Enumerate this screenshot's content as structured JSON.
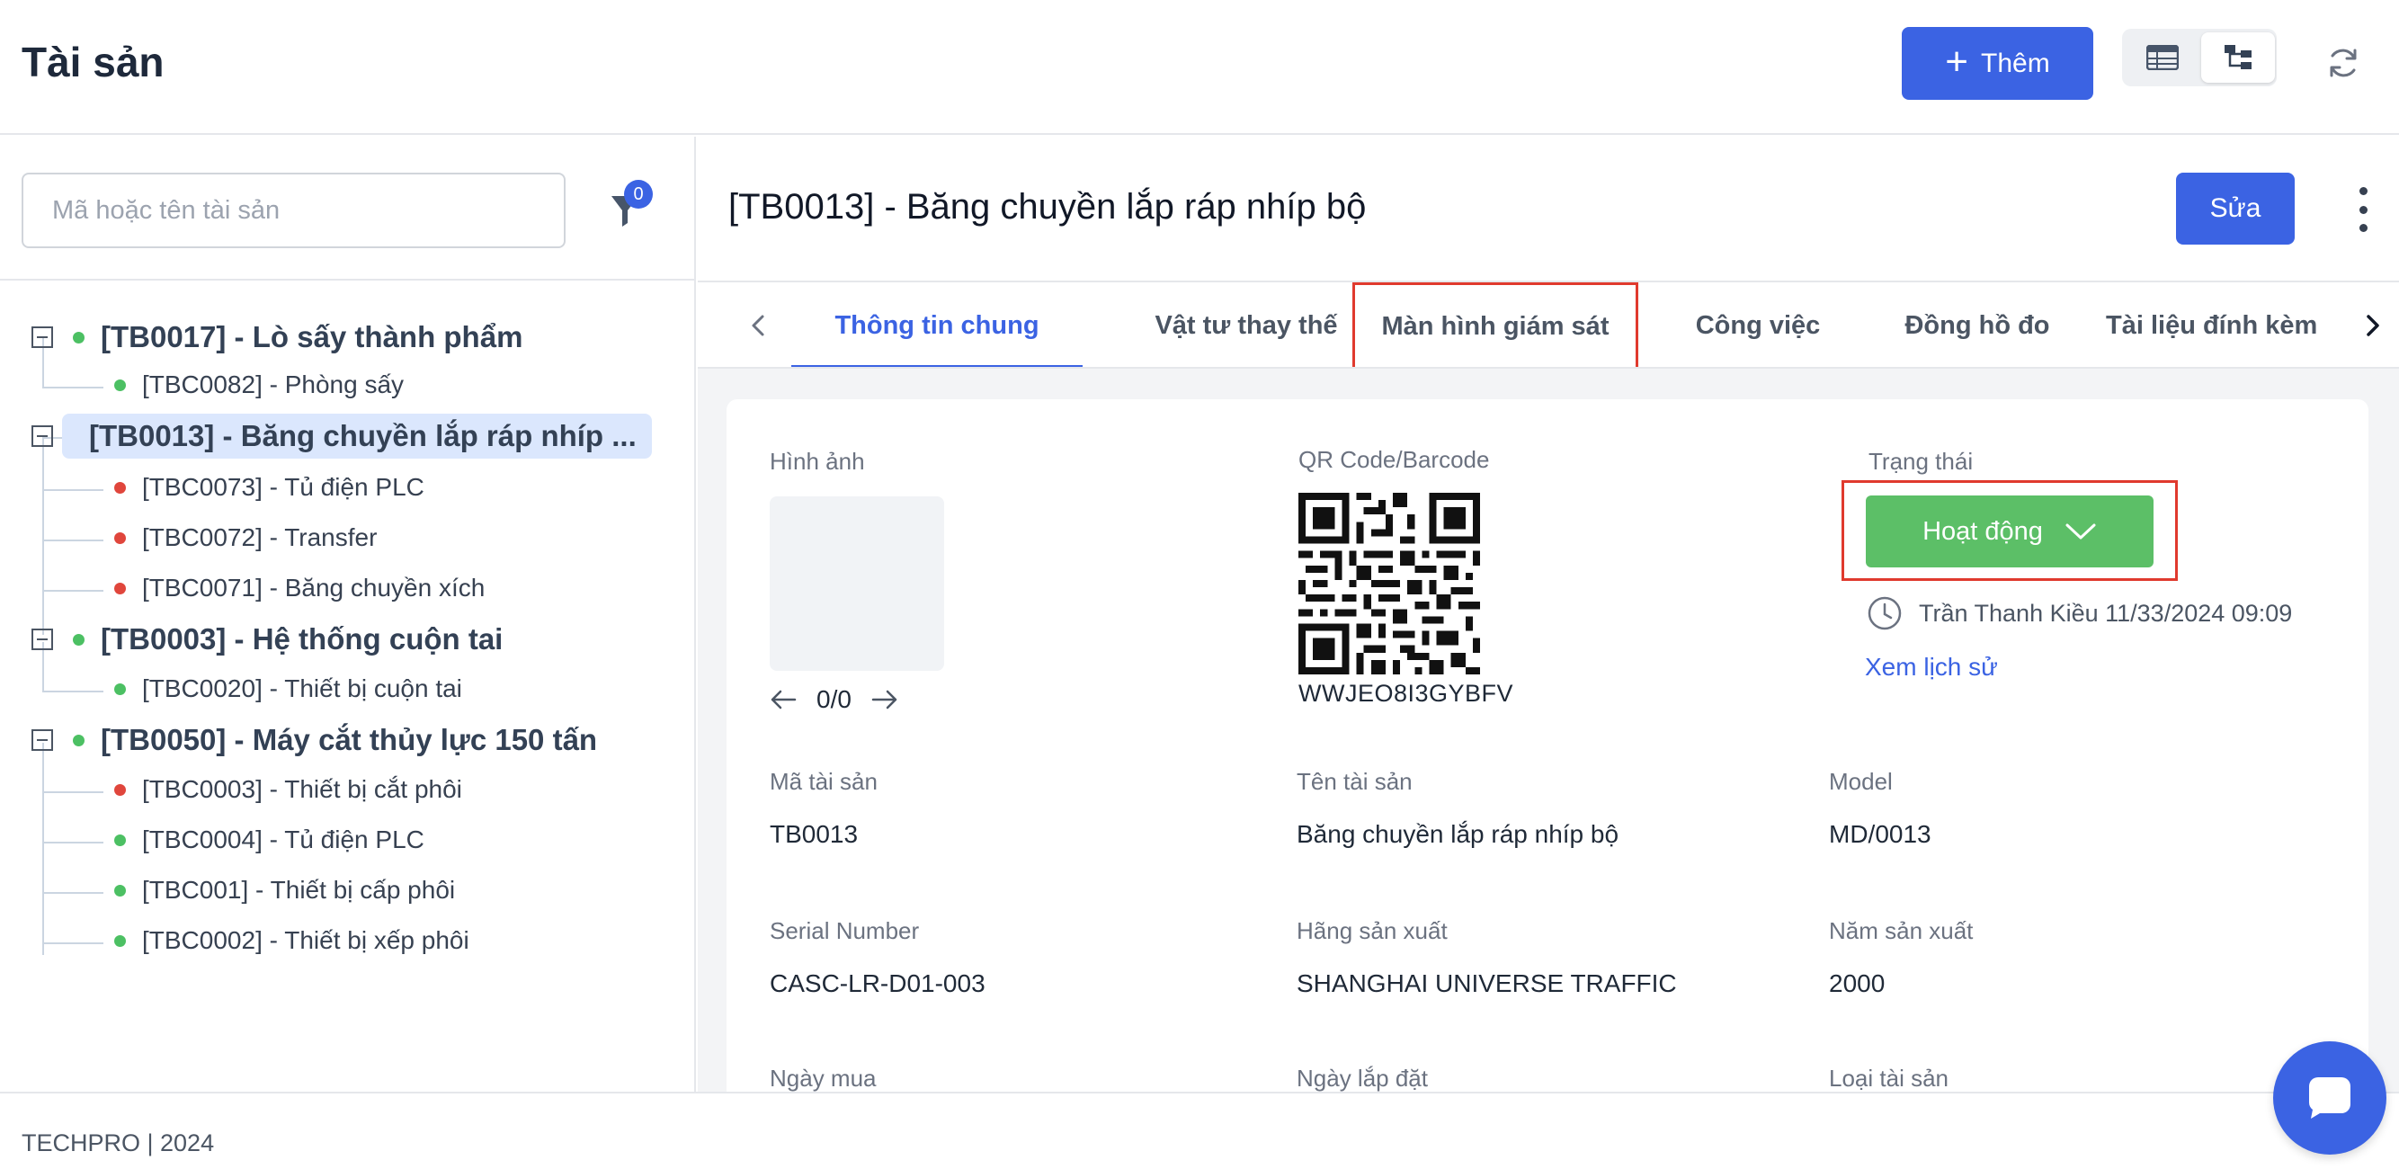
{
  "header": {
    "title": "Tài sản",
    "add_button": "Thêm",
    "view_modes": [
      "table-view-icon",
      "tree-view-icon"
    ],
    "active_view": "tree-view-icon"
  },
  "sidebar": {
    "search_placeholder": "Mã hoặc tên tài sản",
    "filter_count": "0",
    "tree": [
      {
        "label": "[TB0017] - Lò sấy thành phẩm",
        "status": "green",
        "children": [
          {
            "label": "[TBC0082] - Phòng sấy",
            "status": "green"
          }
        ]
      },
      {
        "label": "[TB0013] - Băng chuyền lắp ráp nhíp ...",
        "status": "green",
        "selected": true,
        "children": [
          {
            "label": "[TBC0073] - Tủ điện PLC",
            "status": "red"
          },
          {
            "label": "[TBC0072] - Transfer",
            "status": "red"
          },
          {
            "label": "[TBC0071] - Băng chuyền xích",
            "status": "red"
          }
        ]
      },
      {
        "label": "[TB0003] - Hệ thống cuộn tai",
        "status": "green",
        "children": [
          {
            "label": "[TBC0020] - Thiết bị cuộn tai",
            "status": "green"
          }
        ]
      },
      {
        "label": "[TB0050] - Máy cắt thủy lực 150 tấn",
        "status": "green",
        "children": [
          {
            "label": "[TBC0003] - Thiết bị cắt phôi",
            "status": "red"
          },
          {
            "label": "[TBC0004] - Tủ điện PLC",
            "status": "green"
          },
          {
            "label": "[TBC001] - Thiết bị cấp phôi",
            "status": "green"
          },
          {
            "label": "[TBC0002] - Thiết bị xếp phôi",
            "status": "green"
          }
        ]
      }
    ]
  },
  "detail": {
    "title": "[TB0013] - Băng chuyền lắp ráp nhíp bộ",
    "edit_button": "Sửa",
    "tabs": [
      {
        "label": "Thông tin chung",
        "active": true
      },
      {
        "label": "Vật tư thay thế"
      },
      {
        "label": "Màn hình giám sát",
        "highlighted": true
      },
      {
        "label": "Công việc"
      },
      {
        "label": "Đồng hồ đo"
      },
      {
        "label": "Tài liệu đính kèm"
      }
    ],
    "image": {
      "label": "Hình ảnh",
      "counter": "0/0"
    },
    "qr": {
      "label": "QR Code/Barcode",
      "code": "WWJEO8I3GYBFV"
    },
    "status": {
      "label": "Trạng thái",
      "value": "Hoạt động",
      "updated_by": "Trần Thanh Kiều 11/33/2024 09:09",
      "history_link": "Xem lịch sử"
    },
    "fields": {
      "asset_code": {
        "label": "Mã tài sản",
        "value": "TB0013"
      },
      "asset_name": {
        "label": "Tên tài sản",
        "value": "Băng chuyền lắp ráp nhíp bộ"
      },
      "model": {
        "label": "Model",
        "value": "MD/0013"
      },
      "serial": {
        "label": "Serial Number",
        "value": "CASC-LR-D01-003"
      },
      "manufacturer": {
        "label": "Hãng sản xuất",
        "value": "SHANGHAI UNIVERSE TRAFFIC"
      },
      "year": {
        "label": "Năm sản xuất",
        "value": "2000"
      },
      "purchase_date": {
        "label": "Ngày mua"
      },
      "install_date": {
        "label": "Ngày lắp đặt"
      },
      "asset_type": {
        "label": "Loại tài sản"
      }
    }
  },
  "footer": {
    "text": "TECHPRO | 2024"
  },
  "colors": {
    "primary": "#3b63e3",
    "active_status": "#5cbf67",
    "ok_dot": "#4cc063",
    "error_dot": "#e0463c",
    "highlight": "#e03a2e"
  }
}
